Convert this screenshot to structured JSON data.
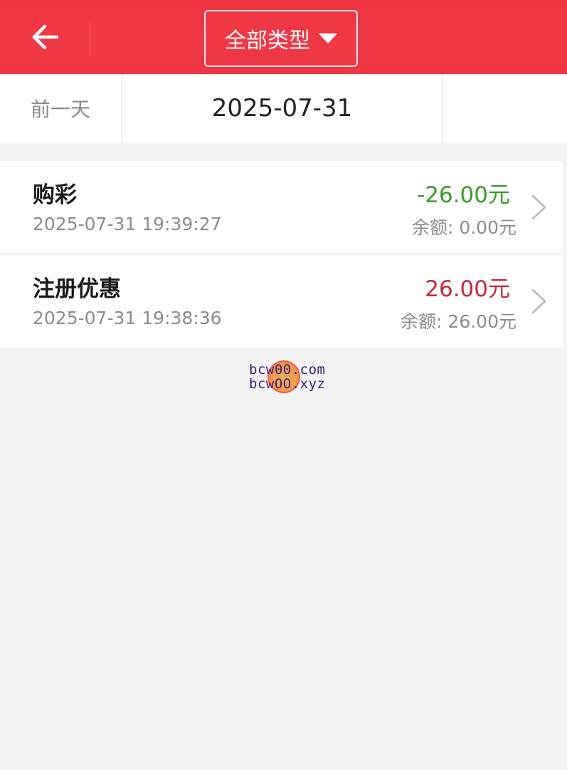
{
  "header": {
    "back_icon": "arrow-left-icon",
    "type_filter_label": "全部类型",
    "type_filter_icon": "caret-down-icon",
    "background_color": "#f03946"
  },
  "date_nav": {
    "prev_label": "前一天",
    "current_date": "2025-07-31",
    "next_label": ""
  },
  "transactions": [
    {
      "title": "购彩",
      "time": "2025-07-31 19:39:27",
      "amount": "-26.00元",
      "balance": "余额: 0.00元",
      "amount_color": "#3c9a2b"
    },
    {
      "title": "注册优惠",
      "time": "2025-07-31 19:38:36",
      "amount": "26.00元",
      "balance": "余额: 26.00元",
      "amount_color": "#c8283b"
    }
  ],
  "watermark": {
    "line1": "bcw00.com",
    "line2": "bcwOO.xyz"
  }
}
